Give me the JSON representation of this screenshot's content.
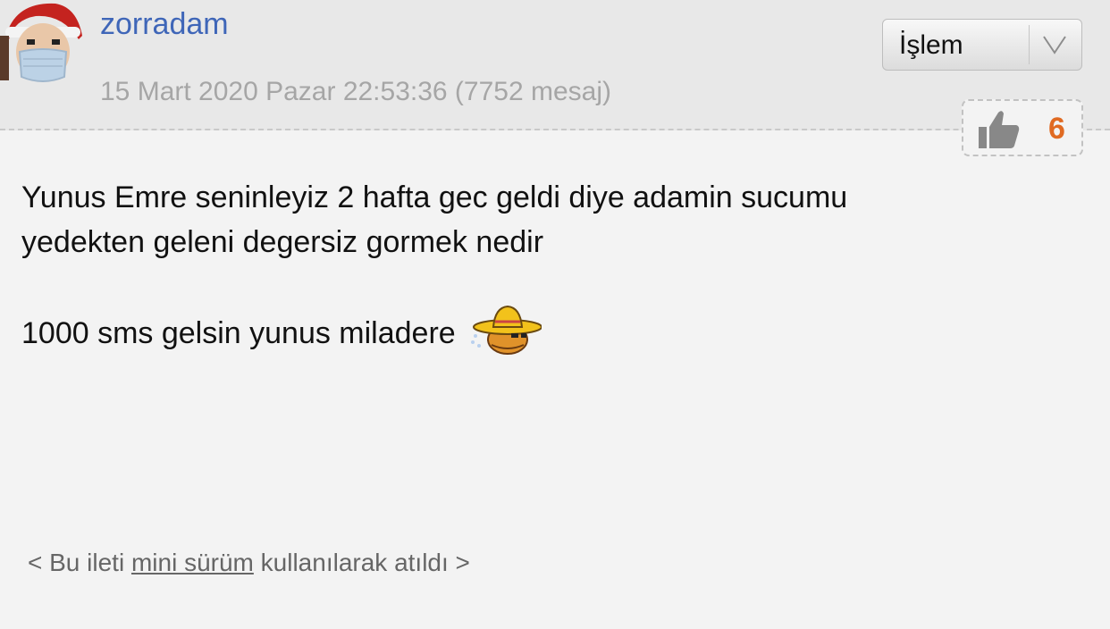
{
  "post": {
    "username": "zorradam",
    "meta": "15 Mart 2020 Pazar 22:53:36 (7752 mesaj)",
    "action_select": {
      "selected": "İşlem"
    },
    "likes": "6",
    "body": {
      "line1": "Yunus Emre seninleyiz 2 hafta gec geldi diye adamin sucumu",
      "line2": "yedekten geleni degersiz gormek nedir",
      "line3": "1000 sms gelsin yunus miladere"
    },
    "footer": {
      "prefix": "< Bu ileti",
      "link": "mini sürüm",
      "suffix": "kullanılarak atıldı >"
    }
  },
  "icons": {
    "avatar": "santa-masked-avatar",
    "dropdown": "chevron-down-icon",
    "like": "thumb-up-icon",
    "smiley": "sombrero-smiley"
  },
  "colors": {
    "username": "#3f66b8",
    "meta": "#a6a6a6",
    "like_count": "#e06a22",
    "background": "#f3f3f3",
    "header_background": "#e8e8e8"
  }
}
